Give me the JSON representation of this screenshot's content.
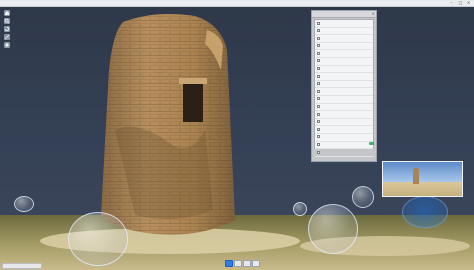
{
  "window": {
    "title": "",
    "controls": [
      "minimize-icon",
      "maximize-icon",
      "close-icon"
    ]
  },
  "toolbar": {
    "tools": [
      "home-icon",
      "zoom-icon",
      "rotate-icon",
      "measure-icon",
      "settings-icon"
    ]
  },
  "panel": {
    "close_icon": "close-icon",
    "rows": [
      "",
      "",
      "",
      "",
      "",
      "",
      "",
      "",
      "",
      "",
      "",
      "",
      "",
      "",
      "",
      "",
      "",
      ""
    ],
    "apply_color": "#3cb371"
  },
  "pager": {
    "pages": 4,
    "active_page": 1,
    "active_color": "#2f7de1"
  },
  "colors": {
    "background": "#2e3849",
    "panel": "#c4c6ca"
  }
}
